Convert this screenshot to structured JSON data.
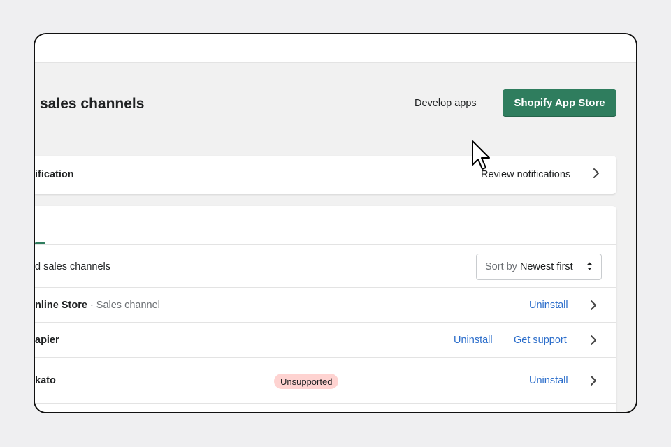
{
  "header": {
    "title": "sales channels",
    "develop_apps": "Develop apps",
    "app_store_button": "Shopify App Store"
  },
  "notification": {
    "title": "ification",
    "review_link": "Review notifications"
  },
  "list": {
    "installed_label": "d sales channels",
    "sort": {
      "prefix": "Sort by",
      "value": "Newest first"
    },
    "rows": [
      {
        "name": "nline Store",
        "separator": "·",
        "type": "Sales channel",
        "uninstall": "Uninstall"
      },
      {
        "name": "apier",
        "uninstall": "Uninstall",
        "support": "Get support"
      },
      {
        "name": "kato",
        "badge": "Unsupported",
        "uninstall": "Uninstall"
      }
    ]
  },
  "colors": {
    "primary_button": "#2f7d5e",
    "link": "#2c6ecb",
    "badge_bg": "#fed3d1",
    "page_bg": "#f1f1f1"
  },
  "icons": {
    "chevron": "chevron-right-icon",
    "sort": "sort-arrows-icon",
    "cursor": "mouse-pointer-icon"
  }
}
